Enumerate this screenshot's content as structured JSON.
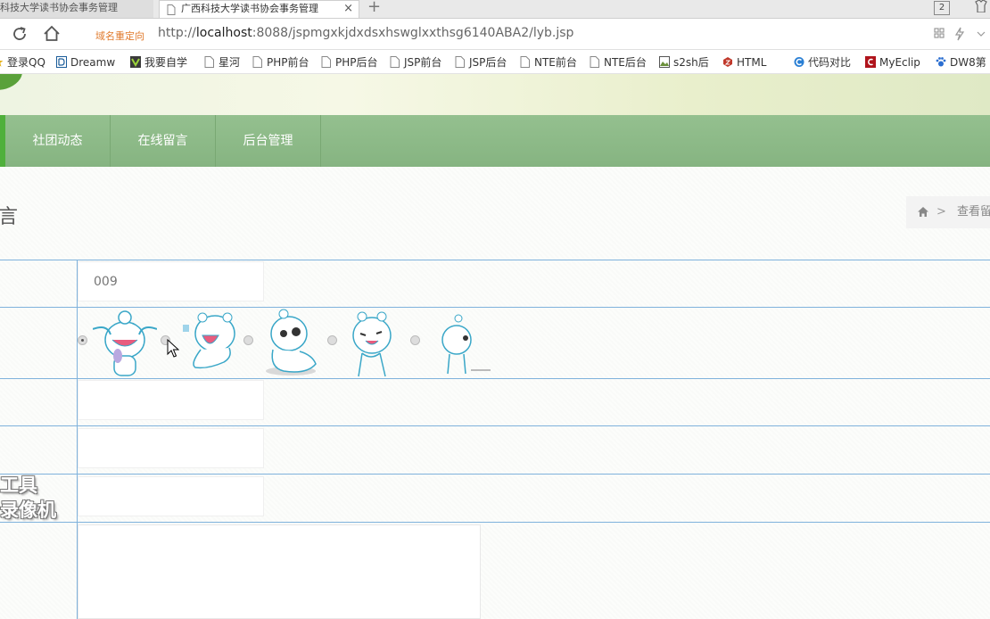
{
  "browser": {
    "tabs": [
      {
        "title": "科技大学读书协会事务管理",
        "active": false
      },
      {
        "title": "广西科技大学读书协会事务管理",
        "active": true
      }
    ],
    "tab_count": "2",
    "redirect_label": "域名重定向",
    "url_prefix": "http://",
    "url_host": "localhost",
    "url_rest": ":8088/jspmgxkjdxdsxhswglxxthsg6140ABA2/lyb.jsp",
    "bookmarks": [
      {
        "label": "登录QQ",
        "icon": "star-icon"
      },
      {
        "label": "Dreamw",
        "icon": "dreamweaver-icon"
      },
      {
        "label": "我要自学",
        "icon": "v-icon"
      },
      {
        "label": "星河",
        "icon": "page-icon"
      },
      {
        "label": "PHP前台",
        "icon": "page-icon"
      },
      {
        "label": "PHP后台",
        "icon": "page-icon"
      },
      {
        "label": "JSP前台",
        "icon": "page-icon"
      },
      {
        "label": "JSP后台",
        "icon": "page-icon"
      },
      {
        "label": "NTE前台",
        "icon": "page-icon"
      },
      {
        "label": "NTE后台",
        "icon": "page-icon"
      },
      {
        "label": "s2sh后",
        "icon": "image-icon"
      },
      {
        "label": "HTML",
        "icon": "html-icon"
      },
      {
        "label": "代码对比",
        "icon": "c-icon"
      },
      {
        "label": "MyEclip",
        "icon": "myeclipse-icon"
      },
      {
        "label": "DW8第",
        "icon": "paw-icon"
      }
    ]
  },
  "site": {
    "nav": [
      {
        "label": "社团动态"
      },
      {
        "label": "在线留言"
      },
      {
        "label": "后台管理"
      }
    ],
    "page_title": "言",
    "breadcrumb": {
      "home_icon": "home-icon",
      "separator": ">",
      "label": "查看留"
    },
    "form": {
      "id_value": "009",
      "faces": [
        {
          "name": "face-crying",
          "selected": true
        },
        {
          "name": "face-laughing",
          "selected": false
        },
        {
          "name": "face-shy",
          "selected": false
        },
        {
          "name": "face-happy",
          "selected": false
        },
        {
          "name": "face-walking",
          "selected": false
        }
      ]
    },
    "watermark": {
      "line1": "工具",
      "line2": "录像机"
    }
  },
  "colors": {
    "nav_green": "#8cbb87",
    "accent_green": "#4fb03b",
    "form_line_blue": "#7fb2dc",
    "redirect_orange": "#e07a2c"
  }
}
